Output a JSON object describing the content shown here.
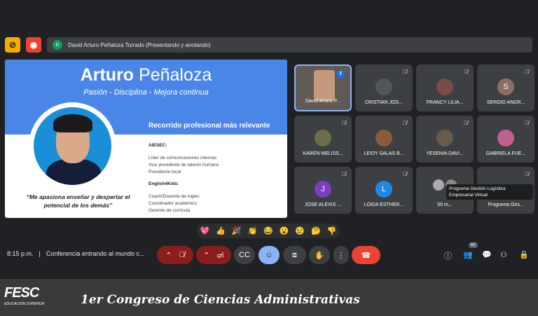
{
  "presenter_bar": {
    "initial": "D",
    "text": "David Arturo Peñaloza Torrado (Presentando y anotando)"
  },
  "slide": {
    "title_first": "Arturo",
    "title_last": " Peñaloza",
    "subtitle": "Pasión - Disciplina - Mejora continua",
    "section_title": "Recorrido profesional más relevante",
    "org1": "AIESEC:",
    "org1_items": [
      "Líder de comunicaciones internas",
      "Vice presidente de talento humano",
      "Presidente local"
    ],
    "org2": "English4Kids:",
    "org2_items": [
      "Coach/Docente de inglés",
      "Coordinador académico",
      "Gerente de currícula"
    ],
    "quote": "“Me apasiona enseñar y despertar el potencial de los demás”"
  },
  "participants": [
    {
      "name": "David Arturo P...",
      "initial": "",
      "color": "#5f5a55"
    },
    {
      "name": "CRISTIAN JOS...",
      "initial": "",
      "color": "#555"
    },
    {
      "name": "FRANCY LILIA...",
      "initial": "",
      "color": "#7a4a4a"
    },
    {
      "name": "SERGIO ANDR...",
      "initial": "S",
      "color": "#8d6e63"
    },
    {
      "name": "KAREN MELISS...",
      "initial": "",
      "color": "#6d6d4a"
    },
    {
      "name": "LEIDY SALAS B...",
      "initial": "",
      "color": "#8a5a3a"
    },
    {
      "name": "YESENIA DAVI...",
      "initial": "",
      "color": "#6a5a4a"
    },
    {
      "name": "GABRIELA FUE...",
      "initial": "",
      "color": "#c06090"
    },
    {
      "name": "JOSE ALEXIS ...",
      "initial": "J",
      "color": "#7b3fbf"
    },
    {
      "name": "LOIDA ESTHER...",
      "initial": "L",
      "color": "#1e88e5"
    },
    {
      "name": "50 m...",
      "initial": "",
      "color": "#777"
    },
    {
      "name": "Programa Ges...",
      "initial": "",
      "color": "#555"
    }
  ],
  "tooltip": {
    "line1": "Programa Gestión Logística",
    "line2": "Empresarial Virtual"
  },
  "reactions": [
    "💖",
    "👍",
    "🎉",
    "👏",
    "😂",
    "😮",
    "😢",
    "🤔",
    "👎"
  ],
  "meeting": {
    "time": "8:15 p.m.",
    "separator": "|",
    "title": "Conferencia entrando al mundo c..."
  },
  "people_count": "62",
  "banner": {
    "logo": "FESC",
    "logo_sub": "EDUCACIÓN SUPERIOR",
    "text": "1er  Congreso de Ciencias Administrativas"
  }
}
